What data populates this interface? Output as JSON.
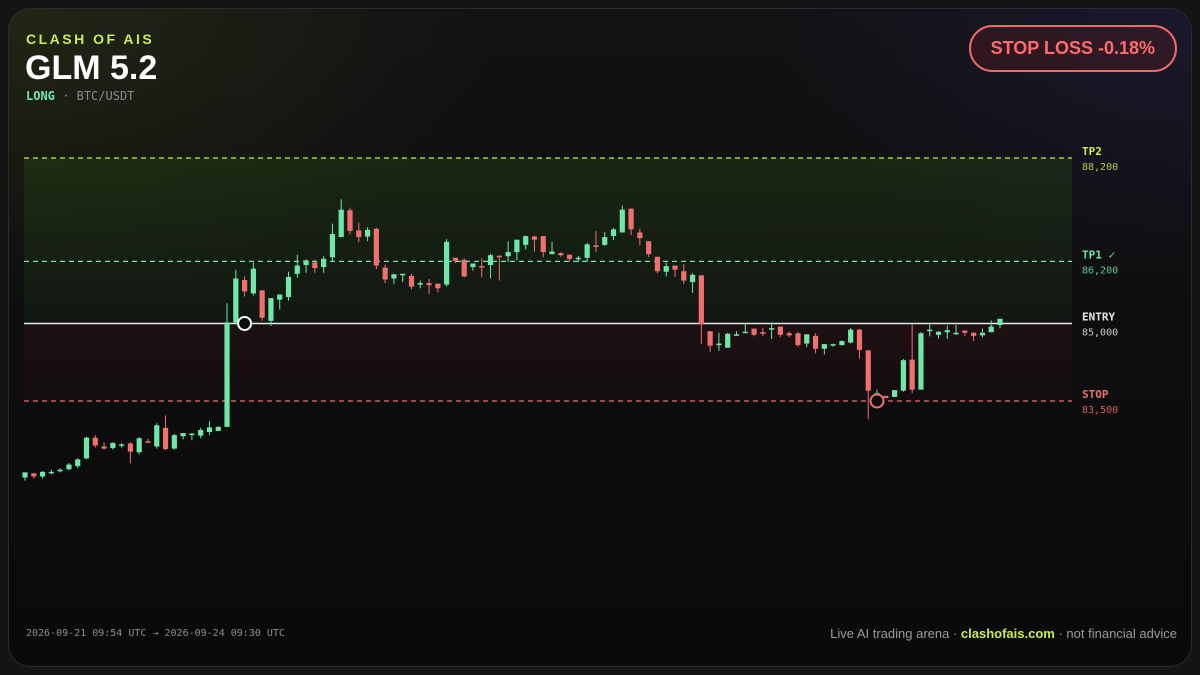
{
  "header": {
    "brand": "CLASH OF AIS",
    "model": "GLM 5.2",
    "side": "LONG",
    "separator": "·",
    "pair": "BTC/USDT"
  },
  "badge": {
    "text": "STOP LOSS -0.18%"
  },
  "footer": {
    "range_start": "2026-09-21 09:54 UTC",
    "range_arrow": "→",
    "range_end": "2026-09-24 09:30 UTC",
    "prefix": "Live AI trading arena ·",
    "site": "clashofais.com",
    "suffix": "· not financial advice"
  },
  "colors": {
    "up": "#6ee7a8",
    "down": "#f07070",
    "tp2": "#c6ef4e",
    "tp1": "#6ee7a8",
    "entry": "#e6e6e6",
    "stop": "#f07070",
    "brand": "#c6ef4e"
  },
  "chart_data": {
    "type": "candlestick",
    "ylim": [
      81000,
      88900
    ],
    "levels": [
      {
        "name": "TP2",
        "value": 88200,
        "label": "88,200",
        "color": "#c6ef4e",
        "style": "dashed"
      },
      {
        "name": "TP1 ✓",
        "value": 86200,
        "label": "86,200",
        "color": "#6ee7a8",
        "style": "dashed"
      },
      {
        "name": "ENTRY",
        "value": 85000,
        "label": "85,000",
        "color": "#e6e6e6",
        "style": "solid"
      },
      {
        "name": "STOP",
        "value": 83500,
        "label": "83,500",
        "color": "#f07070",
        "style": "dashed"
      }
    ],
    "markers": [
      {
        "name": "entry-marker",
        "index": 25,
        "price": 85000,
        "color": "#ffffff"
      },
      {
        "name": "stop-marker",
        "index": 97,
        "price": 83500,
        "color": "#f07070"
      }
    ],
    "candles": [
      [
        82020,
        82120,
        81960,
        82120
      ],
      [
        82100,
        82040,
        82000,
        82110
      ],
      [
        82040,
        82130,
        82000,
        82140
      ],
      [
        82120,
        82130,
        82080,
        82170
      ],
      [
        82140,
        82170,
        82120,
        82200
      ],
      [
        82180,
        82270,
        82160,
        82300
      ],
      [
        82240,
        82370,
        82200,
        82390
      ],
      [
        82390,
        82790,
        82370,
        82810
      ],
      [
        82790,
        82640,
        82600,
        82840
      ],
      [
        82620,
        82580,
        82560,
        82700
      ],
      [
        82590,
        82690,
        82560,
        82700
      ],
      [
        82640,
        82660,
        82600,
        82690
      ],
      [
        82680,
        82520,
        82300,
        82700
      ],
      [
        82510,
        82780,
        82470,
        82800
      ],
      [
        82720,
        82710,
        82700,
        82770
      ],
      [
        82620,
        83030,
        82580,
        83070
      ],
      [
        82980,
        82570,
        82550,
        83220
      ],
      [
        82580,
        82840,
        82560,
        82860
      ],
      [
        82820,
        82880,
        82760,
        82880
      ],
      [
        82850,
        82870,
        82740,
        82880
      ],
      [
        82830,
        82940,
        82780,
        82980
      ],
      [
        82900,
        82990,
        82840,
        83110
      ],
      [
        82920,
        83000,
        82940,
        83010
      ],
      [
        83000,
        85020,
        83000,
        85390
      ],
      [
        85020,
        85870,
        84980,
        86040
      ],
      [
        85840,
        85620,
        85520,
        85910
      ],
      [
        85580,
        86060,
        85540,
        86180
      ],
      [
        85640,
        85110,
        85050,
        85110
      ],
      [
        85050,
        85490,
        84950,
        85400
      ],
      [
        85460,
        85560,
        85270,
        85500
      ],
      [
        85510,
        85900,
        85440,
        86000
      ],
      [
        85960,
        86120,
        85880,
        86330
      ],
      [
        86130,
        86220,
        85980,
        86240
      ],
      [
        86180,
        86070,
        85980,
        86230
      ],
      [
        86090,
        86250,
        85980,
        86300
      ],
      [
        86280,
        86730,
        86190,
        86930
      ],
      [
        86670,
        87200,
        86940,
        87400
      ],
      [
        87190,
        86790,
        86720,
        87240
      ],
      [
        86800,
        86670,
        86570,
        86950
      ],
      [
        86680,
        86810,
        86590,
        86860
      ],
      [
        86830,
        86120,
        86050,
        86850
      ],
      [
        86080,
        85850,
        85780,
        86140
      ],
      [
        85870,
        85950,
        85760,
        85960
      ],
      [
        85940,
        85960,
        85800,
        85960
      ],
      [
        85920,
        85710,
        85660,
        85960
      ],
      [
        85770,
        85780,
        85680,
        85830
      ],
      [
        85780,
        85740,
        85570,
        85860
      ],
      [
        85770,
        85680,
        85600,
        85770
      ],
      [
        85750,
        86580,
        85710,
        86630
      ],
      [
        86270,
        86210,
        86170,
        86250
      ],
      [
        86230,
        85910,
        85890,
        86260
      ],
      [
        86090,
        86160,
        86020,
        86130
      ],
      [
        86110,
        86090,
        85890,
        86260
      ],
      [
        86130,
        86320,
        85870,
        86350
      ],
      [
        86310,
        86280,
        85830,
        86320
      ],
      [
        86300,
        86380,
        86190,
        86590
      ],
      [
        86380,
        86620,
        86220,
        86610
      ],
      [
        86520,
        86690,
        86430,
        86700
      ],
      [
        86680,
        86620,
        86390,
        86700
      ],
      [
        86690,
        86380,
        86280,
        86480
      ],
      [
        86340,
        86390,
        86380,
        86580
      ],
      [
        86360,
        86320,
        86290,
        86380
      ],
      [
        86330,
        86250,
        86200,
        86330
      ],
      [
        86240,
        86270,
        86190,
        86310
      ],
      [
        86270,
        86530,
        86190,
        86560
      ],
      [
        86510,
        86480,
        86380,
        86790
      ],
      [
        86520,
        86670,
        86500,
        86770
      ],
      [
        86690,
        86820,
        86610,
        86850
      ],
      [
        86760,
        87200,
        86840,
        87280
      ],
      [
        87220,
        86820,
        86710,
        87220
      ],
      [
        86760,
        86650,
        86510,
        86830
      ],
      [
        86590,
        86340,
        86280,
        86590
      ],
      [
        86290,
        86010,
        85970,
        86290
      ],
      [
        86000,
        86110,
        85910,
        86180
      ],
      [
        86120,
        86040,
        85900,
        86120
      ],
      [
        86010,
        85830,
        85760,
        86150
      ],
      [
        85800,
        85940,
        85590,
        85970
      ],
      [
        85930,
        84980,
        84600,
        85940
      ],
      [
        84850,
        84570,
        84450,
        84850
      ],
      [
        84610,
        84610,
        84470,
        84820
      ],
      [
        84530,
        84800,
        84550,
        84820
      ],
      [
        84770,
        84790,
        84760,
        84850
      ],
      [
        84820,
        84840,
        84830,
        85010
      ],
      [
        84900,
        84780,
        84750,
        84900
      ],
      [
        84830,
        84820,
        84760,
        84920
      ],
      [
        84880,
        84910,
        84700,
        85020
      ],
      [
        84940,
        84780,
        84740,
        84930
      ],
      [
        84810,
        84770,
        84730,
        84840
      ],
      [
        84810,
        84580,
        84550,
        84830
      ],
      [
        84610,
        84790,
        84540,
        84790
      ],
      [
        84760,
        84510,
        84420,
        84810
      ],
      [
        84510,
        84600,
        84400,
        84580
      ],
      [
        84580,
        84600,
        84550,
        84610
      ],
      [
        84580,
        84660,
        84600,
        84670
      ],
      [
        84630,
        84880,
        84610,
        84910
      ],
      [
        84880,
        84490,
        84320,
        84890
      ],
      [
        84480,
        83700,
        83150,
        84380
      ],
      [
        83560,
        83650,
        83500,
        83720
      ],
      [
        83600,
        83560,
        83560,
        83600
      ],
      [
        83580,
        83710,
        83600,
        83710
      ],
      [
        83700,
        84290,
        83680,
        84310
      ],
      [
        84300,
        83720,
        83650,
        84980
      ],
      [
        83720,
        84810,
        83920,
        84830
      ],
      [
        84850,
        84880,
        84750,
        84980
      ],
      [
        84780,
        84840,
        84710,
        84850
      ],
      [
        84830,
        84870,
        84700,
        84960
      ],
      [
        84810,
        84820,
        84780,
        84970
      ],
      [
        84860,
        84820,
        84760,
        84870
      ],
      [
        84820,
        84760,
        84660,
        84830
      ],
      [
        84770,
        84820,
        84730,
        84900
      ],
      [
        84830,
        84940,
        84840,
        85060
      ],
      [
        84970,
        85090,
        84910,
        85060
      ]
    ]
  }
}
